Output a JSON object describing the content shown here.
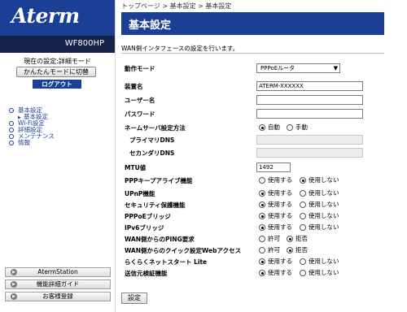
{
  "sidebar": {
    "logo": "Aterm",
    "model": "WF800HP",
    "mode_label": "現在の設定:詳細モード",
    "mode_switch": "かんたんモードに切替",
    "logout": "ログアウト",
    "nav": [
      {
        "label": "基本設定",
        "sub": false
      },
      {
        "label": "基本設定",
        "sub": true
      },
      {
        "label": "Wi-Fi設定",
        "sub": false
      },
      {
        "label": "詳細設定",
        "sub": false
      },
      {
        "label": "メンテナンス",
        "sub": false
      },
      {
        "label": "情報",
        "sub": false
      }
    ],
    "footer_buttons": [
      "AtermStation",
      "機能詳細ガイド",
      "お客様登録"
    ]
  },
  "breadcrumb": "トップページ > 基本設定 > 基本設定",
  "page_title": "基本設定",
  "description": "WAN側インタフェースの設定を行います。",
  "form": {
    "operation_mode": {
      "label": "動作モード",
      "value": "PPPoEルータ"
    },
    "device_name": {
      "label": "装置名",
      "value": "ATERM-XXXXXX"
    },
    "user_name": {
      "label": "ユーザー名",
      "value": ""
    },
    "password": {
      "label": "パスワード",
      "value": ""
    },
    "dns_method": {
      "label": "ネームサーバ設定方法",
      "options": [
        "自動",
        "手動"
      ],
      "selected": 0
    },
    "primary_dns": {
      "label": "プライマリDNS",
      "value": ""
    },
    "secondary_dns": {
      "label": "セカンダリDNS",
      "value": ""
    },
    "mtu": {
      "label": "MTU値",
      "value": "1492"
    },
    "ppp_keepalive": {
      "label": "PPPキープアライブ機能",
      "options": [
        "使用する",
        "使用しない"
      ],
      "selected": 1
    },
    "upnp": {
      "label": "UPnP機能",
      "options": [
        "使用する",
        "使用しない"
      ],
      "selected": 0
    },
    "security": {
      "label": "セキュリティ保護機能",
      "options": [
        "使用する",
        "使用しない"
      ],
      "selected": 0
    },
    "pppoe_bridge": {
      "label": "PPPoEブリッジ",
      "options": [
        "使用する",
        "使用しない"
      ],
      "selected": 0
    },
    "ipv6_bridge": {
      "label": "IPv6ブリッジ",
      "options": [
        "使用する",
        "使用しない"
      ],
      "selected": 0
    },
    "wan_ping": {
      "label": "WAN側からのPING要求",
      "options": [
        "許可",
        "拒否"
      ],
      "selected": 1
    },
    "wan_quick": {
      "label": "WAN側からのクイック設定Webアクセス",
      "options": [
        "許可",
        "拒否"
      ],
      "selected": 1
    },
    "easy_net": {
      "label": "らくらくネットスタート Lite",
      "options": [
        "使用する",
        "使用しない"
      ],
      "selected": 0
    },
    "source_check": {
      "label": "送信元検証機能",
      "options": [
        "使用する",
        "使用しない"
      ],
      "selected": 0
    }
  },
  "submit": "設定"
}
